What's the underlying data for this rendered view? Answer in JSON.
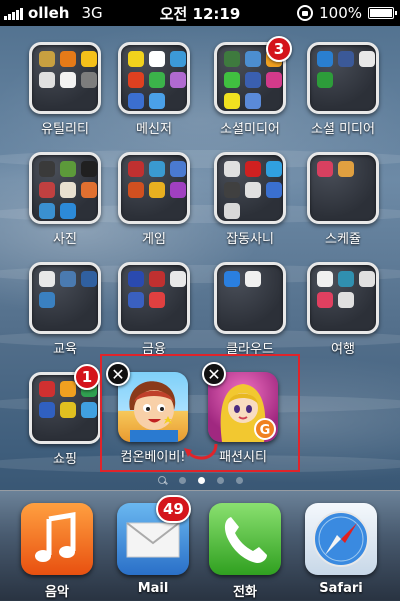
{
  "status_bar": {
    "carrier": "olleh",
    "network": "3G",
    "time": "오전 12:19",
    "battery": "100%"
  },
  "folders": [
    {
      "label": "유틸리티"
    },
    {
      "label": "메신저"
    },
    {
      "label": "소셜미디어",
      "badge": "3"
    },
    {
      "label": "소셜 미디어"
    },
    {
      "label": "사진"
    },
    {
      "label": "게임"
    },
    {
      "label": "잡동사니"
    },
    {
      "label": "스케쥴"
    },
    {
      "label": "교육"
    },
    {
      "label": "금융"
    },
    {
      "label": "클라우드"
    },
    {
      "label": "여행"
    },
    {
      "label": "쇼핑",
      "badge": "1"
    }
  ],
  "apps": [
    {
      "label": "컴온베이비!",
      "icon": "baby-character-icon"
    },
    {
      "label": "패션시티",
      "icon": "fashion-girl-icon"
    }
  ],
  "close_glyph": "✕",
  "dock": [
    {
      "label": "음악",
      "icon": "music-note-icon"
    },
    {
      "label": "Mail",
      "icon": "envelope-icon",
      "badge": "49"
    },
    {
      "label": "전화",
      "icon": "phone-handset-icon"
    },
    {
      "label": "Safari",
      "icon": "compass-icon"
    }
  ],
  "colors": {
    "badge": "#d4141b",
    "highlight": "#e0242a"
  }
}
